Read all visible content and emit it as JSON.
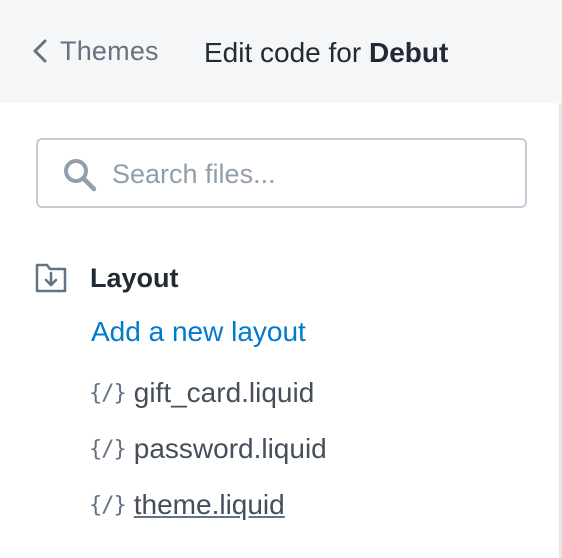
{
  "header": {
    "back_label": "Themes",
    "title_prefix": "Edit code for",
    "theme_name": "Debut"
  },
  "search": {
    "placeholder": "Search files..."
  },
  "folder": {
    "label": "Layout",
    "icon": "folder-download-icon",
    "add_link": "Add a new layout",
    "files": [
      {
        "icon": "code-icon",
        "glyph": "{/}",
        "name": "gift_card.liquid"
      },
      {
        "icon": "code-icon",
        "glyph": "{/}",
        "name": "password.liquid"
      },
      {
        "icon": "code-icon",
        "glyph": "{/}",
        "name": "theme.liquid"
      }
    ]
  },
  "colors": {
    "link": "#007ace",
    "text": "#212b36",
    "muted": "#637381",
    "topbar_bg": "#f4f6f8"
  }
}
